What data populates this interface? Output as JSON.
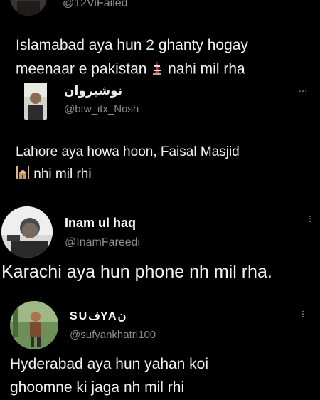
{
  "tweets": [
    {
      "handle": "@12ViFailed",
      "lines": [
        "Islamabad aya hun 2 ghanty hogay",
        "meenaar e pakistan",
        "nahi mil rha"
      ],
      "emoji": "tower-icon"
    },
    {
      "name": "نوشیروان",
      "handle": "@btw_itx_Nosh",
      "more": "...",
      "lines": [
        "Lahore aya howa hoon, Faisal Masjid",
        "nhi mil rhi"
      ],
      "emoji": "mosque-icon"
    },
    {
      "name": "Inam ul haq",
      "handle": "@InamFareedi",
      "more": "...",
      "lines": [
        "Karachi aya hun phone nh mil rha."
      ]
    },
    {
      "name": "SUفYAن",
      "handle": "@sufyankhatri100",
      "more": "...",
      "lines": [
        "Hyderabad aya hun yahan koi",
        "ghoomne ki jaga nh mil rhi"
      ]
    }
  ]
}
